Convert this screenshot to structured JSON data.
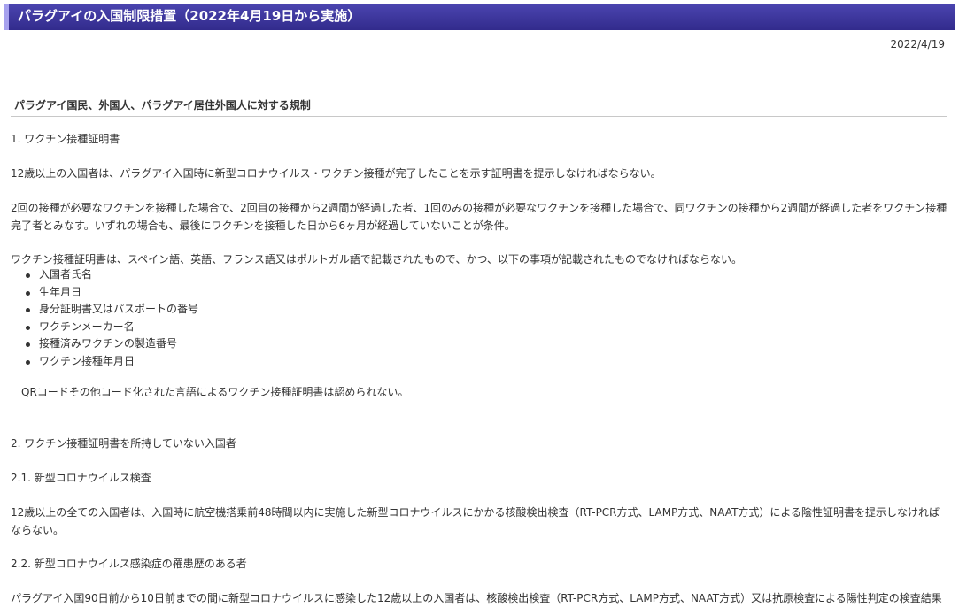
{
  "page_title": "パラグアイの入国制限措置（2022年4月19日から実施）",
  "date": "2022/4/19",
  "section_heading": "パラグアイ国民、外国人、パラグアイ居住外国人に対する規制",
  "s1_title": "1. ワクチン接種証明書",
  "s1_p1": "12歳以上の入国者は、パラグアイ入国時に新型コロナウイルス・ワクチン接種が完了したことを示す証明書を提示しなければならない。",
  "s1_p2": "2回の接種が必要なワクチンを接種した場合で、2回目の接種から2週間が経過した者、1回のみの接種が必要なワクチンを接種した場合で、同ワクチンの接種から2週間が経過した者をワクチン接種完了者とみなす。いずれの場合も、最後にワクチンを接種した日から6ヶ月が経過していないことが条件。",
  "s1_p3": "ワクチン接種証明書は、スペイン語、英語、フランス語又はポルトガル語で記載されたもので、かつ、以下の事項が記載されたものでなければならない。",
  "s1_items": [
    "入国者氏名",
    "生年月日",
    "身分証明書又はパスポートの番号",
    "ワクチンメーカー名",
    "接種済みワクチンの製造番号",
    "ワクチン接種年月日"
  ],
  "s1_note": "QRコードその他コード化された言語によるワクチン接種証明書は認められない。",
  "s2_title": "2. ワクチン接種証明書を所持していない入国者",
  "s2_1_title": "2.1. 新型コロナウイルス検査",
  "s2_1_p": "12歳以上の全ての入国者は、入国時に航空機搭乗前48時間以内に実施した新型コロナウイルスにかかる核酸検出検査（RT-PCR方式、LAMP方式、NAAT方式）による陰性証明書を提示しなければならない。",
  "s2_2_title": "2.2. 新型コロナウイルス感染症の罹患歴のある者",
  "s2_2_p": "パラグアイ入国90日前から10日前までの間に新型コロナウイルスに感染した12歳以上の入国者は、核酸検出検査（RT-PCR方式、LAMP方式、NAAT方式）又は抗原検査による陽性判定の検査結果"
}
